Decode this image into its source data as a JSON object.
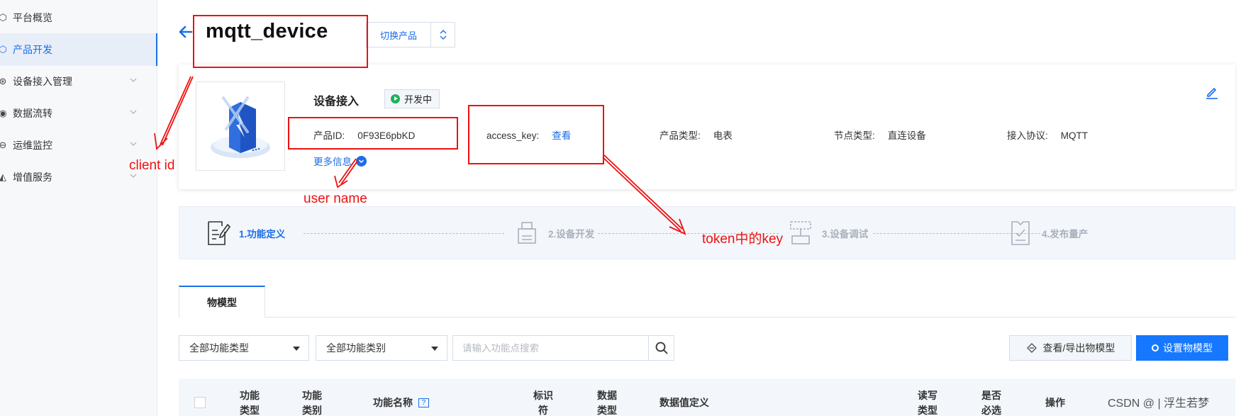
{
  "sidebar": {
    "items": [
      {
        "label": "平台概览",
        "icon": "overview-icon"
      },
      {
        "label": "产品开发",
        "icon": "product-cube-icon",
        "active": true
      },
      {
        "label": "设备接入管理",
        "icon": "device-access-icon",
        "has_chevron": true
      },
      {
        "label": "数据流转",
        "icon": "data-flow-icon",
        "has_chevron": true
      },
      {
        "label": "运维监控",
        "icon": "monitor-icon",
        "has_chevron": true
      },
      {
        "label": "增值服务",
        "icon": "value-service-icon",
        "has_chevron": true
      }
    ]
  },
  "header": {
    "title": "mqtt_device",
    "switch_label": "切换产品"
  },
  "info": {
    "card_title": "设备接入",
    "status": "开发中",
    "product_id_label": "产品ID:",
    "product_id": "0F93E6pbKD",
    "access_key_label": "access_key:",
    "access_key_link": "查看",
    "product_type_label": "产品类型:",
    "product_type": "电表",
    "node_type_label": "节点类型:",
    "node_type": "直连设备",
    "protocol_label": "接入协议:",
    "protocol": "MQTT",
    "more_info": "更多信息"
  },
  "steps": [
    {
      "label": "1.功能定义",
      "state": "active"
    },
    {
      "label": "2.设备开发",
      "state": "inactive"
    },
    {
      "label": "3.设备调试",
      "state": "inactive"
    },
    {
      "label": "4.发布量产",
      "state": "inactive"
    }
  ],
  "tabs": [
    {
      "label": "物模型"
    }
  ],
  "filters": {
    "type_select": "全部功能类型",
    "category_select": "全部功能类别",
    "search_placeholder": "请输入功能点搜索",
    "export_button": "查看/导出物模型",
    "settings_button": "设置物模型"
  },
  "table": {
    "columns": [
      {
        "l1": "功能",
        "l2": "类型"
      },
      {
        "l1": "功能",
        "l2": "类别"
      },
      {
        "l1": "功能名称",
        "l2": ""
      },
      {
        "l1": "标识",
        "l2": "符"
      },
      {
        "l1": "数据",
        "l2": "类型"
      },
      {
        "l1": "数据值定义",
        "l2": ""
      },
      {
        "l1": "读写",
        "l2": "类型"
      },
      {
        "l1": "是否",
        "l2": "必选"
      },
      {
        "l1": "操作",
        "l2": ""
      }
    ]
  },
  "annotations": {
    "client_id": "client id",
    "user_name": "user name",
    "token_key": "token中的key",
    "color": "#ee1111"
  },
  "watermark": "CSDN @ | 浮生若梦",
  "colors": {
    "accent": "#1a6ee8",
    "primary_button": "#1677ff",
    "status_green": "#1bb35c"
  }
}
